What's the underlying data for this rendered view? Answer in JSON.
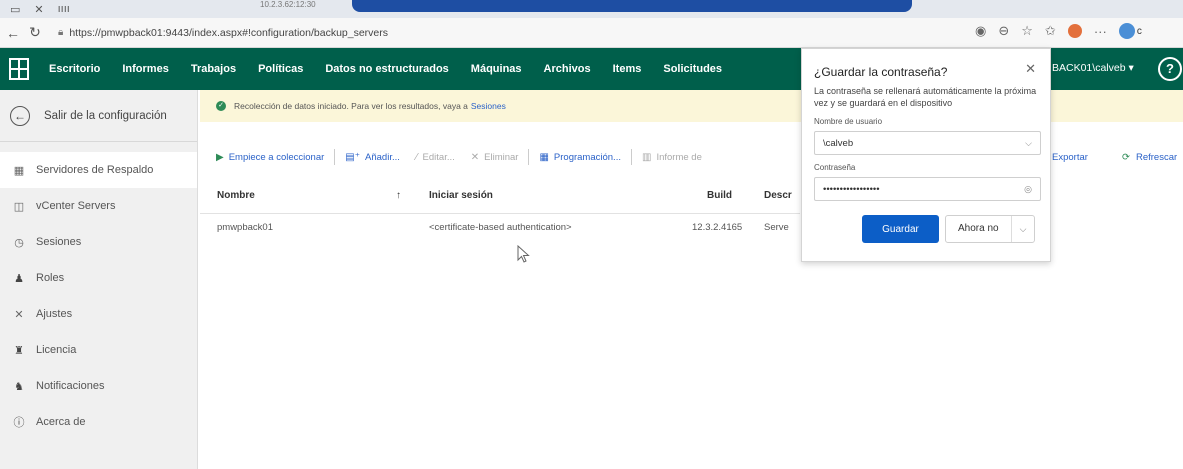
{
  "browser": {
    "tab_glyph": "ıııı",
    "tab_text": "10.2.3.62:12:30",
    "url": "https://pmwpback01:9443/index.aspx#!configuration/backup_servers",
    "profile_initial": "c"
  },
  "topnav": {
    "items": [
      "Escritorio",
      "Informes",
      "Trabajos",
      "Políticas",
      "Datos no estructurados",
      "Máquinas",
      "Archivos",
      "Items",
      "Solicitudes"
    ],
    "user": "BACK01\\calveb ▾",
    "help": "?"
  },
  "sidebar": {
    "exit_label": "Salir de la configuración",
    "items": [
      {
        "label": "Servidores de Respaldo",
        "icon": "server-icon",
        "active": true
      },
      {
        "label": "vCenter Servers",
        "icon": "vcenter-icon",
        "active": false
      },
      {
        "label": "Sesiones",
        "icon": "clock-icon",
        "active": false
      },
      {
        "label": "Roles",
        "icon": "user-icon",
        "active": false
      },
      {
        "label": "Ajustes",
        "icon": "tools-icon",
        "active": false
      },
      {
        "label": "Licencia",
        "icon": "license-icon",
        "active": false
      },
      {
        "label": "Notificaciones",
        "icon": "bell-icon",
        "active": false
      },
      {
        "label": "Acerca de",
        "icon": "info-icon",
        "active": false
      }
    ]
  },
  "banner": {
    "text": "Recolección de datos iniciado. Para ver los resultados, vaya a",
    "link": "Sesiones"
  },
  "toolbar": {
    "collect": "Empiece a coleccionar",
    "add": "Añadir...",
    "edit": "Editar...",
    "remove": "Eliminar",
    "schedule": "Programación...",
    "report": "Informe de",
    "export": "Exportar",
    "refresh": "Refrescar"
  },
  "grid": {
    "columns": [
      "Nombre",
      "Iniciar sesión",
      "Build",
      "Descr"
    ],
    "sort_indicator": "↑",
    "rows": [
      {
        "name": "pmwpback01",
        "login": "<certificate-based authentication>",
        "build": "12.3.2.4165",
        "desc": "Serve"
      }
    ]
  },
  "password_dialog": {
    "title": "¿Guardar la contraseña?",
    "description": "La contraseña se rellenará automáticamente la próxima vez y se guardará en el dispositivo",
    "username_label": "Nombre de usuario",
    "username_value": "\\calveb",
    "password_label": "Contraseña",
    "password_value": "•••••••••••••••••",
    "save_button": "Guardar",
    "not_now_button": "Ahora no"
  }
}
